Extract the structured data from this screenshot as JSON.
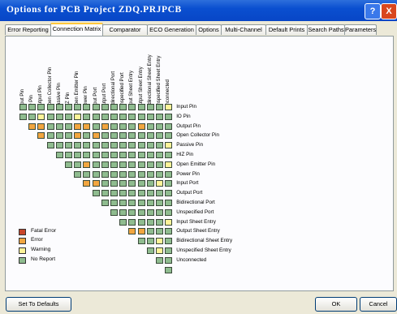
{
  "window": {
    "title": "Options for PCB Project ZDQ.PRJPCB",
    "help_glyph": "?",
    "close_glyph": "X"
  },
  "tabs": [
    {
      "label": "Error Reporting",
      "active": false
    },
    {
      "label": "Connection Matrix",
      "active": true
    },
    {
      "label": "Comparator",
      "active": false
    },
    {
      "label": "ECO Generation",
      "active": false
    },
    {
      "label": "Options",
      "active": false
    },
    {
      "label": "Multi-Channel",
      "active": false
    },
    {
      "label": "Default Prints",
      "active": false
    },
    {
      "label": "Search Paths",
      "active": false
    },
    {
      "label": "Parameters",
      "active": false
    }
  ],
  "matrix": {
    "pins": [
      "Input Pin",
      "IO Pin",
      "Output Pin",
      "Open Collector Pin",
      "Passive Pin",
      "HIZ Pin",
      "Open Emitter Pin",
      "Power Pin",
      "Input Port",
      "Output Port",
      "Bidirectional Port",
      "Unspecified Port",
      "Input Sheet Entry",
      "Output Sheet Entry",
      "Bidirectional Sheet Entry",
      "Unspecified Sheet Entry",
      "Unconnected"
    ],
    "levels": [
      [
        "N",
        "N",
        "N",
        "N",
        "N",
        "N",
        "N",
        "N",
        "N",
        "N",
        "N",
        "N",
        "N",
        "N",
        "N",
        "N",
        "W"
      ],
      [
        "N",
        "N",
        "W",
        "N",
        "N",
        "N",
        "W",
        "N",
        "N",
        "N",
        "N",
        "N",
        "N",
        "N",
        "N",
        "N",
        "N"
      ],
      [
        "E",
        "E",
        "N",
        "N",
        "N",
        "E",
        "E",
        "N",
        "E",
        "N",
        "N",
        "N",
        "E",
        "N",
        "N",
        "N"
      ],
      [
        "E",
        "N",
        "N",
        "N",
        "E",
        "N",
        "E",
        "N",
        "N",
        "N",
        "N",
        "N",
        "N",
        "N",
        "N"
      ],
      [
        "N",
        "N",
        "N",
        "N",
        "N",
        "N",
        "N",
        "N",
        "N",
        "N",
        "N",
        "N",
        "N",
        "W"
      ],
      [
        "N",
        "N",
        "N",
        "N",
        "N",
        "N",
        "N",
        "N",
        "N",
        "N",
        "N",
        "N",
        "N"
      ],
      [
        "N",
        "N",
        "E",
        "N",
        "N",
        "N",
        "N",
        "N",
        "N",
        "N",
        "N",
        "W"
      ],
      [
        "N",
        "N",
        "N",
        "N",
        "N",
        "N",
        "N",
        "N",
        "N",
        "N",
        "N"
      ],
      [
        "E",
        "E",
        "N",
        "N",
        "N",
        "N",
        "N",
        "N",
        "W",
        "N"
      ],
      [
        "N",
        "N",
        "N",
        "N",
        "N",
        "N",
        "N",
        "N",
        "N"
      ],
      [
        "N",
        "N",
        "N",
        "N",
        "N",
        "N",
        "N",
        "N"
      ],
      [
        "N",
        "N",
        "N",
        "N",
        "N",
        "N",
        "N"
      ],
      [
        "N",
        "N",
        "N",
        "N",
        "N",
        "W"
      ],
      [
        "E",
        "E",
        "N",
        "N",
        "N"
      ],
      [
        "N",
        "N",
        "W",
        "N"
      ],
      [
        "N",
        "W",
        "N"
      ],
      [
        "N",
        "N"
      ],
      [
        "N"
      ]
    ]
  },
  "legend": [
    {
      "label": "Fatal Error",
      "color": "#c8462a"
    },
    {
      "label": "Error",
      "color": "#f2a640"
    },
    {
      "label": "Warning",
      "color": "#fef399"
    },
    {
      "label": "No Report",
      "color": "#8fbc8f"
    }
  ],
  "colors": {
    "N": "#8fbc8f",
    "W": "#fef399",
    "E": "#f2a640",
    "F": "#c8462a"
  },
  "buttons": {
    "defaults": "Set To Defaults",
    "ok": "OK",
    "cancel": "Cancel"
  }
}
